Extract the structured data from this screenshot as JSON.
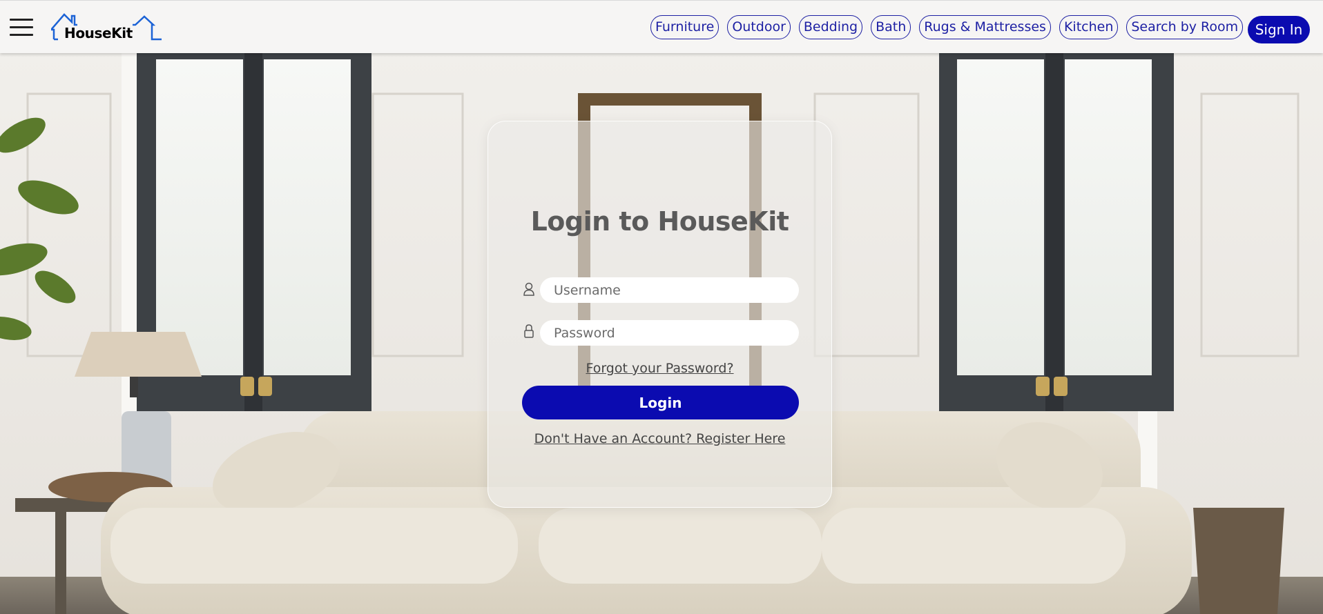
{
  "header": {
    "menu_icon": "hamburger-menu-icon",
    "logo_text": "HouseKit",
    "nav": [
      {
        "label": "Furniture"
      },
      {
        "label": "Outdoor"
      },
      {
        "label": "Bedding"
      },
      {
        "label": "Bath"
      },
      {
        "label": "Rugs & Mattresses"
      },
      {
        "label": "Kitchen"
      },
      {
        "label": "Search by Room"
      }
    ],
    "signin_label": "Sign In"
  },
  "login": {
    "title": "Login to HouseKit",
    "username_placeholder": "Username",
    "username_value": "",
    "password_placeholder": "Password",
    "password_value": "",
    "username_icon": "user-icon",
    "password_icon": "lock-icon",
    "forgot_label": "Forgot your Password?",
    "login_label": "Login",
    "register_label": "Don't Have an Account? Register Here"
  },
  "colors": {
    "brand_blue": "#0b0bb0",
    "nav_blue": "#1c1fa3",
    "header_bg": "#f6f5f4"
  }
}
